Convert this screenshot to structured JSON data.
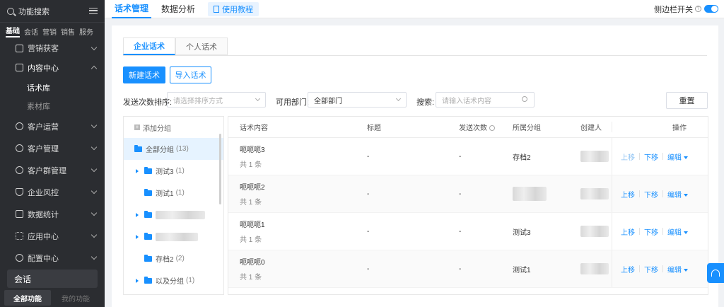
{
  "sidebar": {
    "search_label": "功能搜索",
    "tabs": [
      "基础",
      "会话",
      "营销",
      "销售",
      "服务"
    ],
    "items": [
      {
        "label": "营销获客",
        "icon": "gift-icon"
      },
      {
        "label": "内容中心",
        "icon": "document-icon"
      },
      {
        "label": "客户运营",
        "icon": "user-icon"
      },
      {
        "label": "客户管理",
        "icon": "users-icon"
      },
      {
        "label": "客户群管理",
        "icon": "group-icon"
      },
      {
        "label": "企业风控",
        "icon": "shield-icon"
      },
      {
        "label": "数据统计",
        "icon": "chart-icon"
      },
      {
        "label": "应用中心",
        "icon": "apps-icon"
      },
      {
        "label": "配置中心",
        "icon": "gear-icon"
      }
    ],
    "subitems": [
      "话术库",
      "素材库"
    ],
    "session_label": "会话",
    "all_functions": "全部功能",
    "my_functions": "我的功能"
  },
  "topbar": {
    "tabs": [
      "话术管理",
      "数据分析"
    ],
    "tutorial": "使用教程",
    "sidebar_switch": "侧边栏开关"
  },
  "content": {
    "tabs": [
      "企业话术",
      "个人话术"
    ],
    "new_button": "新建话术",
    "import_button": "导入话术",
    "sort_label": "发送次数排序:",
    "sort_placeholder": "请选择排序方式",
    "dept_label": "可用部门:",
    "dept_value": "全部部门",
    "search_label": "搜索:",
    "search_placeholder": "请输入话术内容",
    "reset_button": "重置"
  },
  "tree": {
    "add_group": "添加分组",
    "nodes": [
      {
        "name": "全部分组",
        "count": "(13)"
      },
      {
        "name": "测试3",
        "count": "(1)"
      },
      {
        "name": "测试1",
        "count": "(1)"
      },
      {
        "name": "",
        "count": ""
      },
      {
        "name": "",
        "count": ""
      },
      {
        "name": "存档2",
        "count": "(2)"
      },
      {
        "name": "以及分组",
        "count": "(1)"
      }
    ]
  },
  "table": {
    "headers": [
      "话术内容",
      "标题",
      "发送次数",
      "所属分组",
      "创建人",
      "操作"
    ],
    "rows": [
      {
        "content": "呃呃呃3",
        "sub": "共 1 条",
        "title": "-",
        "count": "-",
        "group": "存档2"
      },
      {
        "content": "呃呃呃2",
        "sub": "共 1 条",
        "title": "-",
        "count": "-",
        "group": ""
      },
      {
        "content": "呃呃呃1",
        "sub": "共 1 条",
        "title": "-",
        "count": "-",
        "group": "测试3"
      },
      {
        "content": "呃呃呃0",
        "sub": "共 1 条",
        "title": "-",
        "count": "-",
        "group": "测试1"
      }
    ],
    "ops": {
      "up": "上移",
      "down": "下移",
      "edit": "编辑"
    }
  },
  "colors": {
    "accent": "#1890ff",
    "sidebar_bg": "#2b2d31"
  }
}
